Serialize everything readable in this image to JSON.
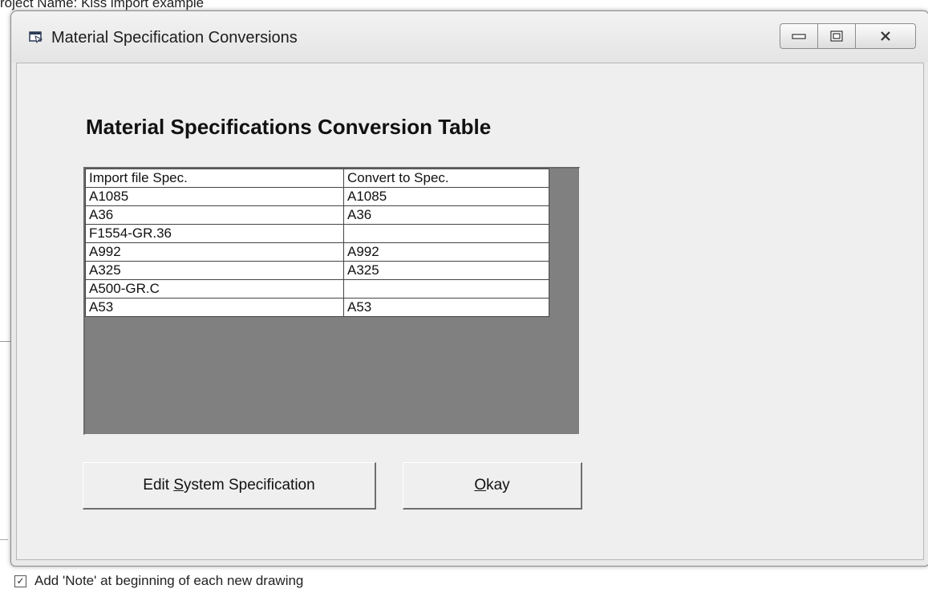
{
  "background": {
    "top_text": "roject Name: Kiss import example",
    "bottom_text": "Add 'Note' at beginning of each new drawing"
  },
  "window": {
    "title": "Material Specification Conversions",
    "icon": "window-app-icon",
    "controls": [
      "minimize-icon",
      "maximize-icon",
      "close-icon"
    ]
  },
  "main": {
    "heading": "Material Specifications Conversion Table",
    "table": {
      "headers": [
        "Import file Spec.",
        "Convert to Spec."
      ],
      "rows": [
        [
          "A1085",
          "A1085"
        ],
        [
          "A36",
          "A36"
        ],
        [
          "F1554-GR.36",
          ""
        ],
        [
          "A992",
          "A992"
        ],
        [
          "A325",
          "A325"
        ],
        [
          "A500-GR.C",
          ""
        ],
        [
          "A53",
          "A53"
        ]
      ]
    },
    "buttons": {
      "edit": {
        "pre": "Edit ",
        "accel": "S",
        "post": "ystem Specification"
      },
      "okay": {
        "pre": "",
        "accel": "O",
        "post": "kay"
      }
    }
  }
}
